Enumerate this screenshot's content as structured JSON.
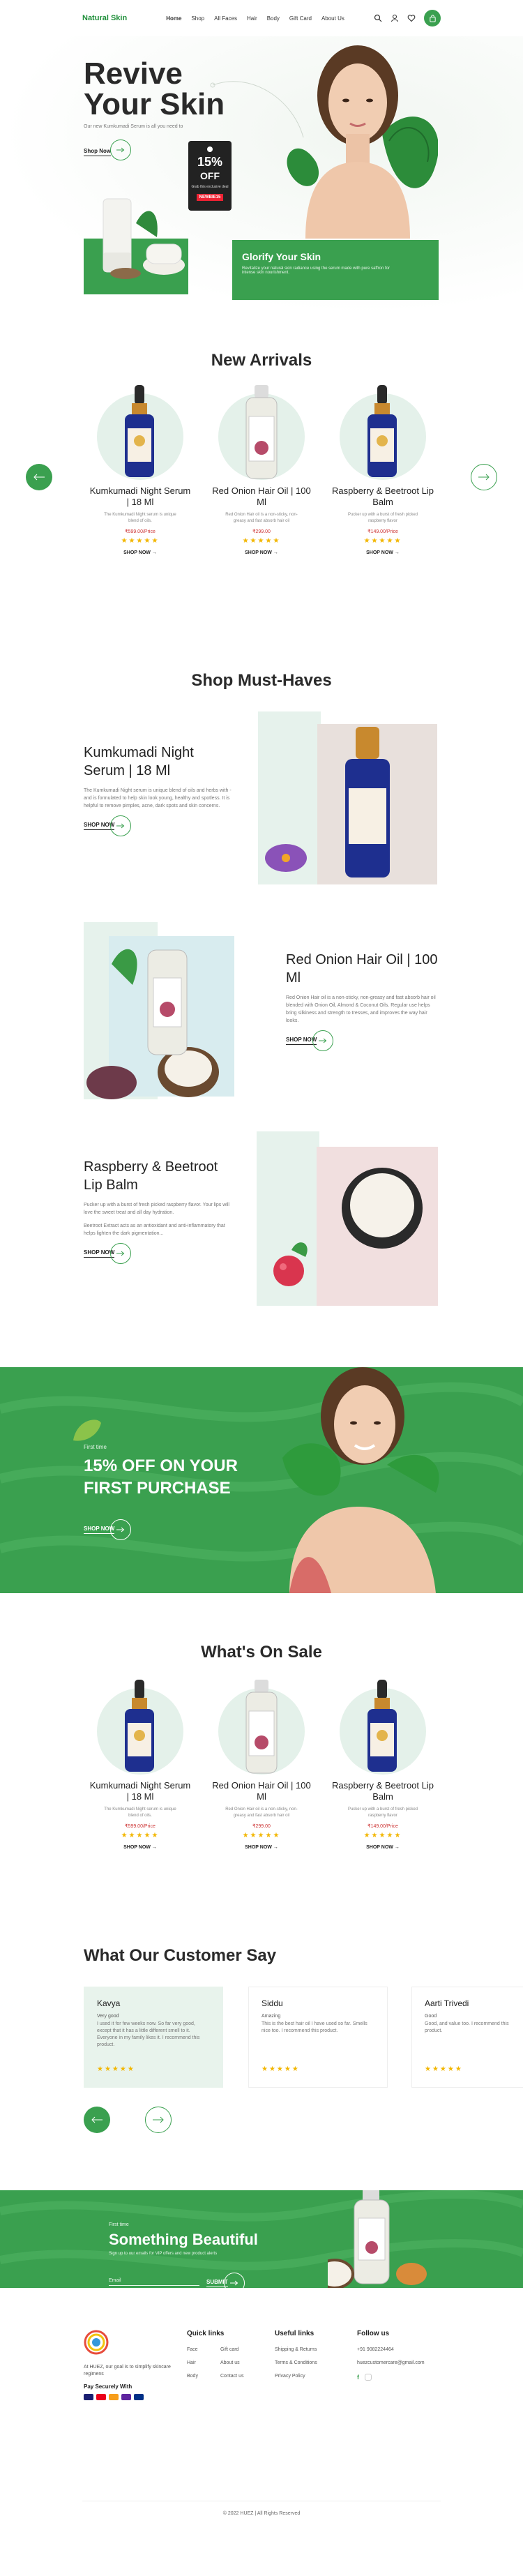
{
  "header": {
    "logo": "Natural Skin",
    "nav": [
      "Home",
      "Shop",
      "All Faces",
      "Hair",
      "Body",
      "Gift Card",
      "About Us"
    ]
  },
  "hero": {
    "title": "Revive Your Skin",
    "subtitle": "Our new Kumkumadi Serum is all you need to",
    "shop_label": "Shop Now",
    "tag_percent": "15%",
    "tag_off": "OFF",
    "tag_small": "Grab this exclusive deal",
    "tag_badge": "NEWBIE15",
    "glory_title": "Glorify Your Skin",
    "glory_text": "Revitalize your natural skin radiance using the serum made with pure saffron for intense skin nourishment."
  },
  "new_arrivals": {
    "title": "New Arrivals",
    "products": [
      {
        "name": "Kumkumadi Night Serum | 18 Ml",
        "desc": "The Kumkumadi Night serum is unique blend of oils.",
        "price": "₹599.00/Price",
        "shop": "SHOP NOW"
      },
      {
        "name": "Red Onion Hair Oil | 100 Ml",
        "desc": "Red Onion Hair oil is a non-sticky, non-greasy and fast absorb hair oil",
        "price": "₹299.00",
        "shop": "SHOP NOW"
      },
      {
        "name": "Raspberry & Beetroot Lip Balm",
        "desc": "Pucker up with a burst of fresh picked raspberry flavor",
        "price": "₹149.00/Price",
        "shop": "SHOP NOW"
      }
    ]
  },
  "must_haves": {
    "title": "Shop Must-Haves",
    "items": [
      {
        "name": "Kumkumadi Night Serum | 18 Ml",
        "text": "The Kumkumadi Night serum is unique blend of oils and herbs with - and is formulated to help skin look young, healthy and spotless. It is helpful to remove pimples, acne, dark spots and skin concerns.",
        "shop": "SHOP NOW"
      },
      {
        "name": "Red Onion Hair Oil | 100 Ml",
        "text": "Red Onion Hair oil is a non-sticky, non-greasy and fast absorb hair oil blended with Onion Oil, Almond & Coconut Oils. Regular use helps bring silkiness and strength to tresses, and improves the way hair looks.",
        "shop": "SHOP NOW"
      },
      {
        "name": "Raspberry & Beetroot Lip Balm",
        "text": "Pucker up with a burst of fresh picked raspberry flavor. Your lips will love the sweet treat and all day hydration.",
        "text2": "Beetroot Extract acts as an antioxidant and anti-inflammatory that helps lighten the dark pigmentation...",
        "shop": "SHOP NOW"
      }
    ]
  },
  "promo": {
    "first": "First time",
    "big": "15% OFF ON YOUR FIRST PURCHASE",
    "shop": "SHOP NOW"
  },
  "on_sale": {
    "title": "What's On Sale",
    "products": [
      {
        "name": "Kumkumadi Night Serum | 18 Ml",
        "desc": "The Kumkumadi Night serum is unique blend of oils.",
        "price": "₹599.00/Price",
        "shop": "SHOP NOW"
      },
      {
        "name": "Red Onion Hair Oil | 100 Ml",
        "desc": "Red Onion Hair oil is a non-sticky, non-greasy and fast absorb hair oil",
        "price": "₹299.00",
        "shop": "SHOP NOW"
      },
      {
        "name": "Raspberry & Beetroot Lip Balm",
        "desc": "Pucker up with a burst of fresh picked raspberry flavor",
        "price": "₹149.00/Price",
        "shop": "SHOP NOW"
      }
    ]
  },
  "testimonials": {
    "title": "What Our Customer Say",
    "items": [
      {
        "name": "Kavya",
        "tag": "Very good",
        "text": "I used it for few weeks now. So far very good, except that it has a little different smell to it. Everyone in my family likes it. I recommend this product."
      },
      {
        "name": "Siddu",
        "tag": "Amazing",
        "text": "This is the best hair oil I have used so far. Smells nice too. I recommend this product."
      },
      {
        "name": "Aarti Trivedi",
        "tag": "Good",
        "text": "Good, and value too. I recommend this product."
      }
    ]
  },
  "newsletter": {
    "first": "First time",
    "title": "Something Beautiful",
    "sub": "Sign up to our emails for VIP offers and new product alerts",
    "email_placeholder": "Email",
    "submit": "SUBMIT"
  },
  "footer": {
    "about": "At HUEZ, our goal is to simplify skincare regimens",
    "pay": "Pay Securely With",
    "quick_title": "Quick links",
    "quick": [
      "Face",
      "Gift card",
      "Hair",
      "About us",
      "Body",
      "Contact us"
    ],
    "useful_title": "Useful links",
    "useful": [
      "Shipping & Returns",
      "Terms & Conditions",
      "Privacy Policy"
    ],
    "follow_title": "Follow us",
    "phone": "+91 9082224464",
    "email": "huezcustomercare@gmail.com",
    "copyright": "© 2022 HUEZ | All Rights Reserved"
  }
}
